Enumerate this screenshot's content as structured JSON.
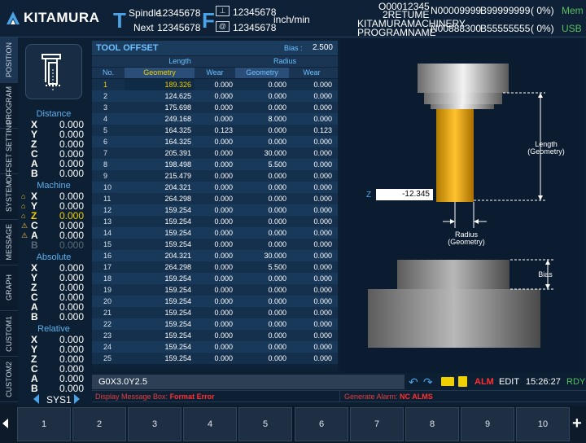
{
  "brand": {
    "name": "KITAMURA"
  },
  "header": {
    "t_letter": "T",
    "spindle_label": "Spindle",
    "spindle_value": "12345678",
    "next_label": "Next",
    "next_value": "12345678",
    "f_letter": "F",
    "f_value1": "12345678",
    "f_value2": "12345678",
    "f_unit": "inch/min",
    "prog_top": "O00012345",
    "prog_name": "2RETUME",
    "prog_n1": "N00009999",
    "prog_b1": "B99999999",
    "prog_pct1": "( 0%)",
    "mode1": "Mem",
    "machine_name": "KITAMURAMACHINERY",
    "program_name": "PROGRAMNAME",
    "prog_n2": "N00888300",
    "prog_b2": "B55555555",
    "prog_pct2": "( 0%)",
    "mode2": "USB"
  },
  "tabs": [
    "POSITION",
    "PROGRAM",
    "OFFSET SETTING",
    "SYSTEM",
    "MESSAGE",
    "GRAPH",
    "CUSTOM1",
    "CUSTOM2"
  ],
  "position": {
    "distance": {
      "title": "Distance",
      "rows": [
        {
          "axis": "X",
          "value": "0.000"
        },
        {
          "axis": "Y",
          "value": "0.000"
        },
        {
          "axis": "Z",
          "value": "0.000"
        },
        {
          "axis": "C",
          "value": "0.000"
        },
        {
          "axis": "A",
          "value": "0.000"
        },
        {
          "axis": "B",
          "value": "0.000"
        }
      ]
    },
    "machine": {
      "title": "Machine",
      "rows": [
        {
          "axis": "X",
          "value": "0.000"
        },
        {
          "axis": "Y",
          "value": "0.000"
        },
        {
          "axis": "Z",
          "value": "0.000"
        },
        {
          "axis": "C",
          "value": "0.000"
        },
        {
          "axis": "A",
          "value": "0.000"
        },
        {
          "axis": "B",
          "value": "0.000"
        }
      ]
    },
    "absolute": {
      "title": "Absolute",
      "rows": [
        {
          "axis": "X",
          "value": "0.000"
        },
        {
          "axis": "Y",
          "value": "0.000"
        },
        {
          "axis": "Z",
          "value": "0.000"
        },
        {
          "axis": "C",
          "value": "0.000"
        },
        {
          "axis": "A",
          "value": "0.000"
        },
        {
          "axis": "B",
          "value": "0.000"
        }
      ]
    },
    "relative": {
      "title": "Relative",
      "rows": [
        {
          "axis": "X",
          "value": "0.000"
        },
        {
          "axis": "Y",
          "value": "0.000"
        },
        {
          "axis": "Z",
          "value": "0.000"
        },
        {
          "axis": "C",
          "value": "0.000"
        },
        {
          "axis": "A",
          "value": "0.000"
        },
        {
          "axis": "B",
          "value": "0.000"
        }
      ]
    },
    "sys": "SYS1"
  },
  "tool_offset": {
    "title": "TOOL OFFSET",
    "bias_label": "Bias :",
    "bias_value": "2.500",
    "group_length": "Length",
    "group_radius": "Radius",
    "col_no": "No.",
    "col_geometry": "Geometry",
    "col_wear": "Wear",
    "col_r_geometry": "Geometry",
    "col_r_wear": "Wear",
    "rows": [
      {
        "no": "1",
        "lg": "189.326",
        "lw": "0.000",
        "rg": "0.000",
        "rw": "0.000"
      },
      {
        "no": "2",
        "lg": "124.625",
        "lw": "0.000",
        "rg": "0.000",
        "rw": "0.000"
      },
      {
        "no": "3",
        "lg": "175.698",
        "lw": "0.000",
        "rg": "0.000",
        "rw": "0.000"
      },
      {
        "no": "4",
        "lg": "249.168",
        "lw": "0.000",
        "rg": "8.000",
        "rw": "0.000"
      },
      {
        "no": "5",
        "lg": "164.325",
        "lw": "0.123",
        "rg": "0.000",
        "rw": "0.123"
      },
      {
        "no": "6",
        "lg": "164.325",
        "lw": "0.000",
        "rg": "0.000",
        "rw": "0.000"
      },
      {
        "no": "7",
        "lg": "205.391",
        "lw": "0.000",
        "rg": "30.000",
        "rw": "0.000"
      },
      {
        "no": "8",
        "lg": "198.498",
        "lw": "0.000",
        "rg": "5.500",
        "rw": "0.000"
      },
      {
        "no": "9",
        "lg": "215.479",
        "lw": "0.000",
        "rg": "0.000",
        "rw": "0.000"
      },
      {
        "no": "10",
        "lg": "204.321",
        "lw": "0.000",
        "rg": "0.000",
        "rw": "0.000"
      },
      {
        "no": "11",
        "lg": "264.298",
        "lw": "0.000",
        "rg": "0.000",
        "rw": "0.000"
      },
      {
        "no": "12",
        "lg": "159.254",
        "lw": "0.000",
        "rg": "0.000",
        "rw": "0.000"
      },
      {
        "no": "13",
        "lg": "159.254",
        "lw": "0.000",
        "rg": "0.000",
        "rw": "0.000"
      },
      {
        "no": "14",
        "lg": "159.254",
        "lw": "0.000",
        "rg": "0.000",
        "rw": "0.000"
      },
      {
        "no": "15",
        "lg": "159.254",
        "lw": "0.000",
        "rg": "0.000",
        "rw": "0.000"
      },
      {
        "no": "16",
        "lg": "204.321",
        "lw": "0.000",
        "rg": "30.000",
        "rw": "0.000"
      },
      {
        "no": "17",
        "lg": "264.298",
        "lw": "0.000",
        "rg": "5.500",
        "rw": "0.000"
      },
      {
        "no": "18",
        "lg": "159.254",
        "lw": "0.000",
        "rg": "0.000",
        "rw": "0.000"
      },
      {
        "no": "19",
        "lg": "159.254",
        "lw": "0.000",
        "rg": "0.000",
        "rw": "0.000"
      },
      {
        "no": "20",
        "lg": "159.254",
        "lw": "0.000",
        "rg": "0.000",
        "rw": "0.000"
      },
      {
        "no": "21",
        "lg": "159.254",
        "lw": "0.000",
        "rg": "0.000",
        "rw": "0.000"
      },
      {
        "no": "22",
        "lg": "159.254",
        "lw": "0.000",
        "rg": "0.000",
        "rw": "0.000"
      },
      {
        "no": "23",
        "lg": "159.254",
        "lw": "0.000",
        "rg": "0.000",
        "rw": "0.000"
      },
      {
        "no": "24",
        "lg": "159.254",
        "lw": "0.000",
        "rg": "0.000",
        "rw": "0.000"
      },
      {
        "no": "25",
        "lg": "159.254",
        "lw": "0.000",
        "rg": "0.000",
        "rw": "0.000"
      }
    ]
  },
  "diagram": {
    "z_label": "Z",
    "z_value": "-12.345",
    "length_label1": "Length",
    "length_label2": "(Geometry)",
    "radius_label1": "Radius",
    "radius_label2": "(Geometry)",
    "bias_label": "Bias"
  },
  "command": {
    "input": "G0X3.0Y2.5"
  },
  "status": {
    "alm": "ALM",
    "edit": "EDIT",
    "time": "15:26:27",
    "rdy": "RDY"
  },
  "messages": {
    "display_label": "Display Message Box:",
    "display_value": "Format Error",
    "alarm_label": "Generate Alarm:",
    "alarm_value": "NC ALMS"
  },
  "softkeys": [
    "1",
    "2",
    "3",
    "4",
    "5",
    "6",
    "7",
    "8",
    "9",
    "10"
  ],
  "colors": {
    "accent": "#4aa3e6",
    "highlight": "#f0d000",
    "alarm": "#ff3030",
    "ready": "#58c060"
  }
}
